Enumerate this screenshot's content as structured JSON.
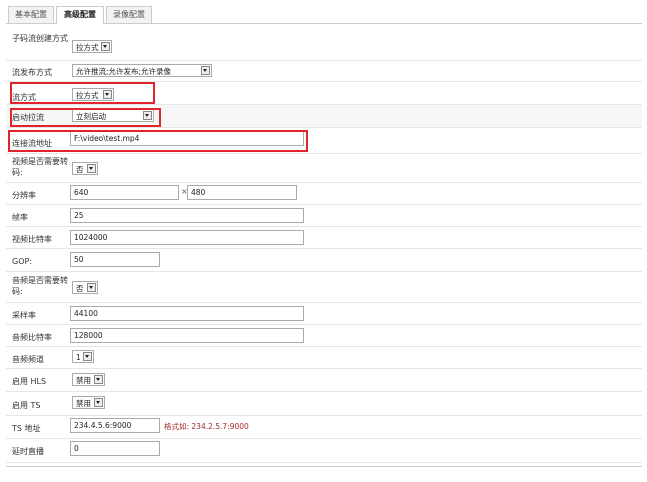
{
  "tabs": [
    {
      "label": "基本配置",
      "active": false
    },
    {
      "label": "高级配置",
      "active": true
    },
    {
      "label": "录像配置",
      "active": false
    }
  ],
  "form": {
    "substream_mode": {
      "label": "子码流创建方式",
      "value": "拉方式"
    },
    "publish_mode": {
      "label": "流发布方式",
      "value": "允许推流;允许发布;允许录像"
    },
    "stream_mode": {
      "label": "流方式",
      "value": "拉方式"
    },
    "start_pull": {
      "label": "启动拉流",
      "value": "立刻启动"
    },
    "connect_url": {
      "label": "连接流地址",
      "value": "F:\\video\\test.mp4"
    },
    "video_transcode": {
      "label": "视频是否需要转码:",
      "value": "否"
    },
    "resolution": {
      "label": "分辨率",
      "width": "640",
      "separator": "×",
      "height": "480"
    },
    "frame_rate": {
      "label": "帧率",
      "value": "25"
    },
    "video_bitrate": {
      "label": "视频比特率",
      "value": "1024000"
    },
    "gop": {
      "label": "GOP:",
      "value": "50"
    },
    "audio_transcode": {
      "label": "音频是否需要转码:",
      "value": "否"
    },
    "sample_rate": {
      "label": "采样率",
      "value": "44100"
    },
    "audio_bitrate": {
      "label": "音频比特率",
      "value": "128000"
    },
    "audio_channels": {
      "label": "音频频道",
      "value": "1"
    },
    "hls": {
      "label": "启用 HLS",
      "value": "禁用"
    },
    "ts": {
      "label": "启用 TS",
      "value": "禁用"
    },
    "ts_addr": {
      "label": "TS 地址",
      "value": "234.4.5.6:9000",
      "hint": "格式如: 234.2.5.7:9000"
    },
    "delay_live": {
      "label": "延时直播",
      "value": "0"
    }
  },
  "colors": {
    "highlight": "#e0242b",
    "hint": "#a52a2a",
    "alt_row": "#f7f7f7"
  }
}
